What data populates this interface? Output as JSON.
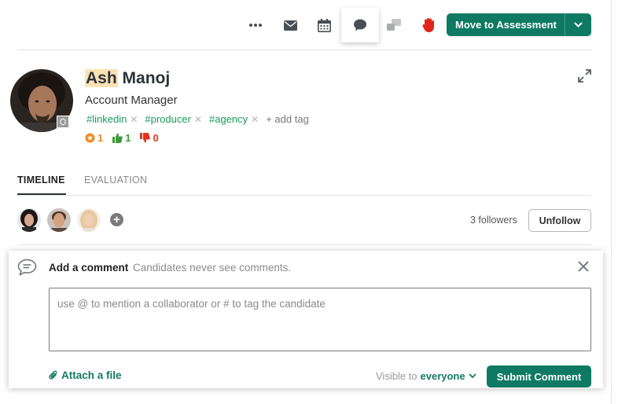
{
  "toolbar": {
    "icons": [
      "more-options-icon",
      "email-icon",
      "calendar-icon",
      "comment-icon",
      "sms-icon",
      "reject-hand-icon"
    ],
    "move_label": "Move to Assessment"
  },
  "candidate": {
    "first_name": "Ash",
    "last_name": "Manoj",
    "title": "Account Manager",
    "tags": [
      "#linkedin",
      "#producer",
      "#agency"
    ],
    "add_tag_label": "+ add tag",
    "stats": {
      "stars": "1",
      "thumbs_up": "1",
      "thumbs_down": "0"
    }
  },
  "tabs": [
    {
      "label": "TIMELINE",
      "active": true
    },
    {
      "label": "EVALUATION",
      "active": false
    }
  ],
  "followers": {
    "count_label": "3 followers",
    "unfollow_label": "Unfollow"
  },
  "comment": {
    "title": "Add a comment",
    "subtitle": "Candidates never see comments.",
    "placeholder": "use @ to mention a collaborator or # to tag the candidate",
    "attach_label": "Attach a file",
    "visible_prefix": "Visible to",
    "visible_value": "everyone",
    "submit_label": "Submit Comment"
  },
  "colors": {
    "brand_green": "#0e7a63",
    "tag_green": "#1a9a5a",
    "star_orange": "#f08a24",
    "thumbs_up_green": "#3d9a3a",
    "thumbs_down_red": "#e0331f",
    "reject_red": "#e2231a",
    "name_highlight": "#fde2b4"
  }
}
